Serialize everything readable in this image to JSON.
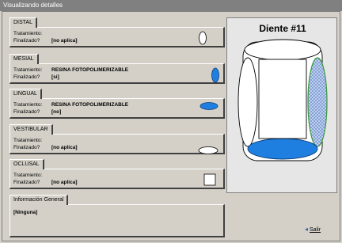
{
  "window": {
    "title": "Visualizando detalles"
  },
  "tooth": {
    "title": "Diente #11"
  },
  "sections": [
    {
      "name": "DISTAL",
      "tratamiento": "",
      "finalizado": "[no aplica]",
      "marker": "ellipse-vertical-white"
    },
    {
      "name": "MESIAL",
      "tratamiento": "RESINA FOTOPOLIMERIZABLE",
      "finalizado": "[si]",
      "marker": "ellipse-vertical-blue"
    },
    {
      "name": "LINGUAL",
      "tratamiento": "RESINA FOTOPOLIMERIZABLE",
      "finalizado": "[no]",
      "marker": "ellipse-horizontal-blue"
    },
    {
      "name": "VESTIBULAR",
      "tratamiento": "",
      "finalizado": "[no aplica]",
      "marker": "ellipse-horizontal-white"
    },
    {
      "name": "OCLUSAL",
      "tratamiento": "",
      "finalizado": "[no aplica]",
      "marker": "square-white"
    }
  ],
  "labels": {
    "tratamiento": "Tratamiento:",
    "finalizado": "Finalizado?"
  },
  "info": {
    "title": "Información General",
    "text": "[Ninguna]"
  },
  "exit": {
    "label": "Salir",
    "icon": "exit-arrow-icon"
  },
  "colors": {
    "blue": "#1f7fe0",
    "hatch": "#9ab8e8",
    "green": "#3a9a3a"
  }
}
